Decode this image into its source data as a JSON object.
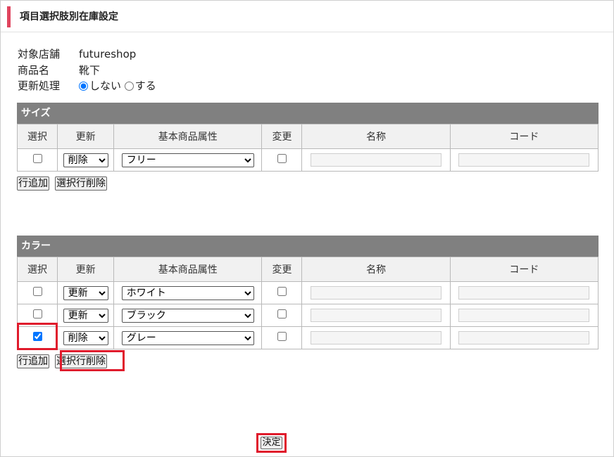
{
  "page_title": "項目選択肢別在庫設定",
  "info": {
    "shop_label": "対象店舗",
    "shop_value": "futureshop",
    "product_label": "商品名",
    "product_value": "靴下",
    "update_label": "更新処理",
    "radio_no": "しない",
    "radio_yes": "する",
    "selected": "しない"
  },
  "columns": {
    "select": "選択",
    "update": "更新",
    "attribute": "基本商品属性",
    "change": "変更",
    "name": "名称",
    "code": "コード"
  },
  "buttons": {
    "add_row": "行追加",
    "delete_selected": "選択行削除",
    "submit": "決定"
  },
  "size_section": {
    "title": "サイズ",
    "rows": [
      {
        "selected": false,
        "update": "削除",
        "attribute": "フリー",
        "changed": false,
        "name": "",
        "code": ""
      }
    ]
  },
  "color_section": {
    "title": "カラー",
    "rows": [
      {
        "selected": false,
        "update": "更新",
        "attribute": "ホワイト",
        "changed": false,
        "name": "",
        "code": ""
      },
      {
        "selected": false,
        "update": "更新",
        "attribute": "ブラック",
        "changed": false,
        "name": "",
        "code": ""
      },
      {
        "selected": true,
        "update": "削除",
        "attribute": "グレー",
        "changed": false,
        "name": "",
        "code": ""
      }
    ]
  },
  "colors": {
    "accent_bar": "#e0455e",
    "section_header": "#808080",
    "highlight": "#e01b2c"
  }
}
